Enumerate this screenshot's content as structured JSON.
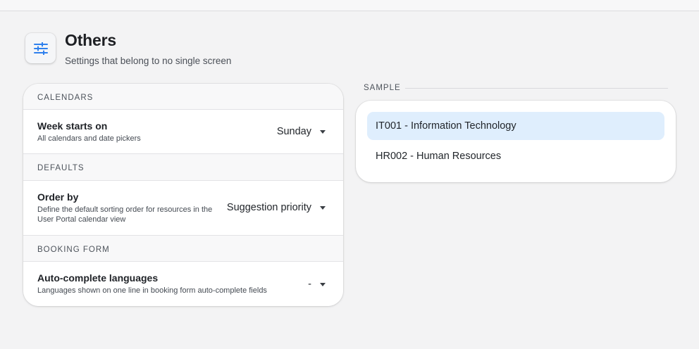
{
  "header": {
    "title": "Others",
    "subtitle": "Settings that belong to no single screen",
    "icon": "sliders-icon",
    "icon_color": "#2f80ed"
  },
  "sections": {
    "calendars": {
      "heading": "CALENDARS",
      "week_start": {
        "title": "Week starts on",
        "desc": "All calendars and date pickers",
        "value": "Sunday"
      }
    },
    "defaults": {
      "heading": "DEFAULTS",
      "order_by": {
        "title": "Order by",
        "desc": "Define the default sorting order for resources in the User Portal calendar view",
        "value": "Suggestion priority"
      }
    },
    "booking_form": {
      "heading": "BOOKING FORM",
      "languages": {
        "title": "Auto-complete languages",
        "desc": "Languages shown on one line in booking form auto-complete fields",
        "value": "-"
      }
    }
  },
  "sample": {
    "label": "SAMPLE",
    "items": [
      {
        "label": "IT001 - Information Technology",
        "selected": true
      },
      {
        "label": "HR002 - Human Resources",
        "selected": false
      }
    ],
    "selected_color": "#dfeefd"
  }
}
